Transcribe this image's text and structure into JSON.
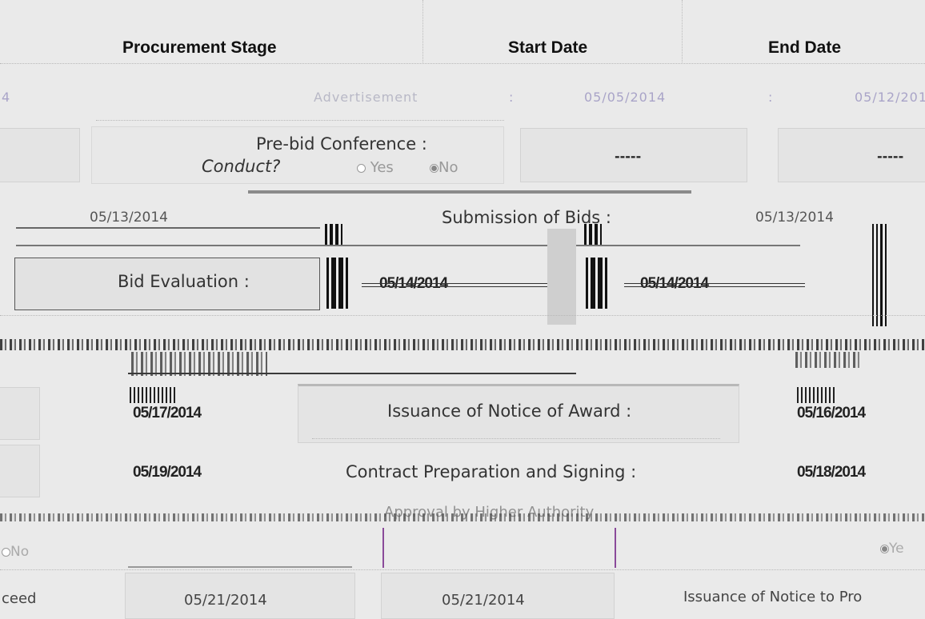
{
  "header": {
    "stage": "Procurement Stage",
    "start": "Start Date",
    "end": "End Date"
  },
  "rows": {
    "advertisement": {
      "stage_fragment": "Advertisement",
      "left_fragment": "4",
      "start": "05/05/2014",
      "end": "05/12/201",
      "sep": ":"
    },
    "prebid": {
      "label": "Pre-bid Conference :",
      "conduct": "Conduct?",
      "yes": "Yes",
      "no": "No",
      "selected": "No",
      "start": "-----",
      "end": "-----"
    },
    "submission": {
      "label": "Submission of Bids  :",
      "start": "05/13/2014",
      "end": "05/13/2014"
    },
    "evaluation": {
      "label": "Bid Evaluation  :",
      "start": "05/14/2014",
      "end": "05/14/2014"
    },
    "award": {
      "label": "Issuance of Notice of Award  :",
      "start": "05/17/2014",
      "end": "05/16/2014"
    },
    "contract": {
      "label": "Contract Preparation and Signing  :",
      "start": "05/19/2014",
      "end": "05/18/2014"
    },
    "approval": {
      "label_fragment": "Approval by Higher Authority",
      "radio_no": "No",
      "radio_yes": "Ye"
    },
    "proceed": {
      "left_fragment": "ceed",
      "start": "05/21/2014",
      "end": "05/21/2014",
      "label": "Issuance of Notice to Pro"
    }
  },
  "colors": {
    "background": "#eaeaea",
    "faint_text": "#a9a4c8",
    "field_border": "#555555"
  }
}
